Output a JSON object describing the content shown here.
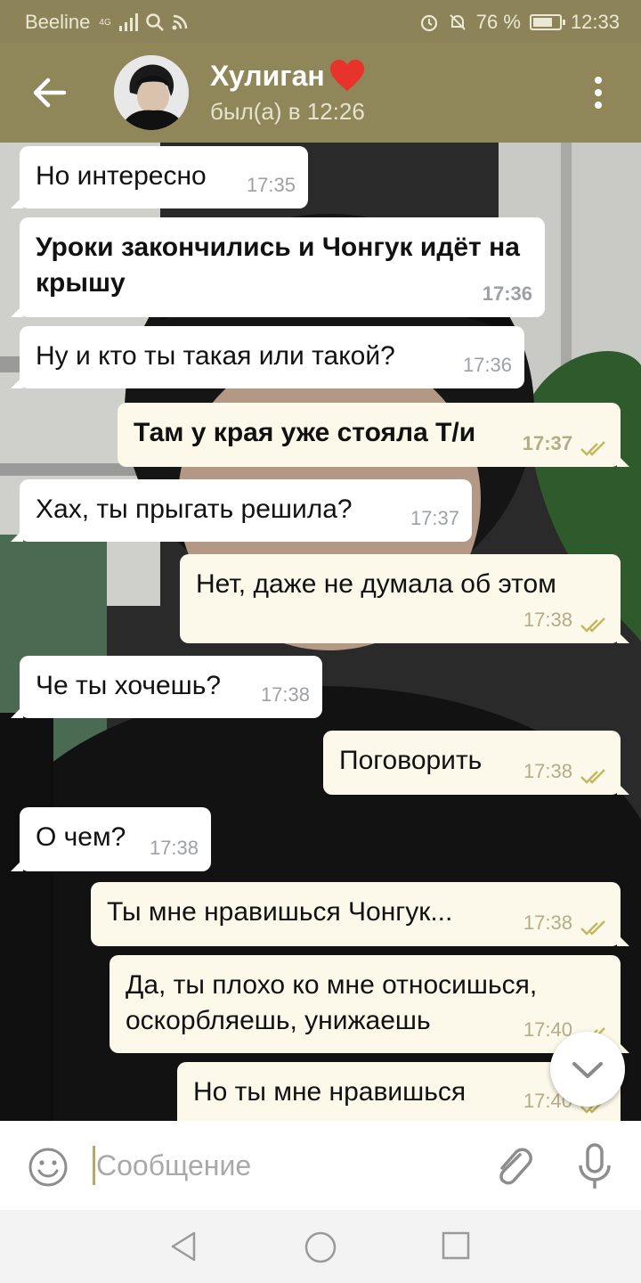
{
  "status_bar": {
    "carrier": "Beeline",
    "network": "4G",
    "battery": "76 %",
    "battery_level": 0.76,
    "time": "12:33"
  },
  "header": {
    "contact_name": "Хулиган",
    "status": "был(а) в 12:26"
  },
  "colors": {
    "header_bg": "#8f875a",
    "status_bar_bg": "#8c8458",
    "incoming_bubble": "#ffffff",
    "outgoing_bubble": "#fcf9ea",
    "read_check": "#c3b761"
  },
  "messages": [
    {
      "direction": "in",
      "text": "Но интересно",
      "time": "17:35",
      "bold": false
    },
    {
      "direction": "in",
      "text": "Уроки закончились и Чонгук идёт на крышу",
      "time": "17:36",
      "bold": true
    },
    {
      "direction": "in",
      "text": "Ну и кто ты такая или такой?",
      "time": "17:36",
      "bold": false
    },
    {
      "direction": "out",
      "text": "Там у края уже стояла Т/и",
      "time": "17:37",
      "bold": true,
      "read": true
    },
    {
      "direction": "in",
      "text": "Хах, ты прыгать решила?",
      "time": "17:37",
      "bold": false
    },
    {
      "direction": "out",
      "text": "Нет, даже не думала об этом",
      "time": "17:38",
      "bold": false,
      "read": true
    },
    {
      "direction": "in",
      "text": "Че ты хочешь?",
      "time": "17:38",
      "bold": false
    },
    {
      "direction": "out",
      "text": "Поговорить",
      "time": "17:38",
      "bold": false,
      "read": true
    },
    {
      "direction": "in",
      "text": "О чем?",
      "time": "17:38",
      "bold": false
    },
    {
      "direction": "out",
      "text": "Ты мне нравишься Чонгук...",
      "time": "17:38",
      "bold": false,
      "read": true
    },
    {
      "direction": "out",
      "text": "Да, ты плохо ко мне относишься, оскорбляешь, унижаешь",
      "time": "17:40",
      "bold": false,
      "read": true
    },
    {
      "direction": "out",
      "text": "Но ты мне нравишься",
      "time": "17:40",
      "bold": false,
      "read": true
    }
  ],
  "composer": {
    "placeholder": "Сообщение"
  },
  "icons": {
    "back": "arrow-left-icon",
    "menu": "kebab-menu-icon",
    "emoji": "smiley-icon",
    "attach": "paperclip-icon",
    "mic": "microphone-icon",
    "scroll_down": "chevron-down-icon"
  }
}
